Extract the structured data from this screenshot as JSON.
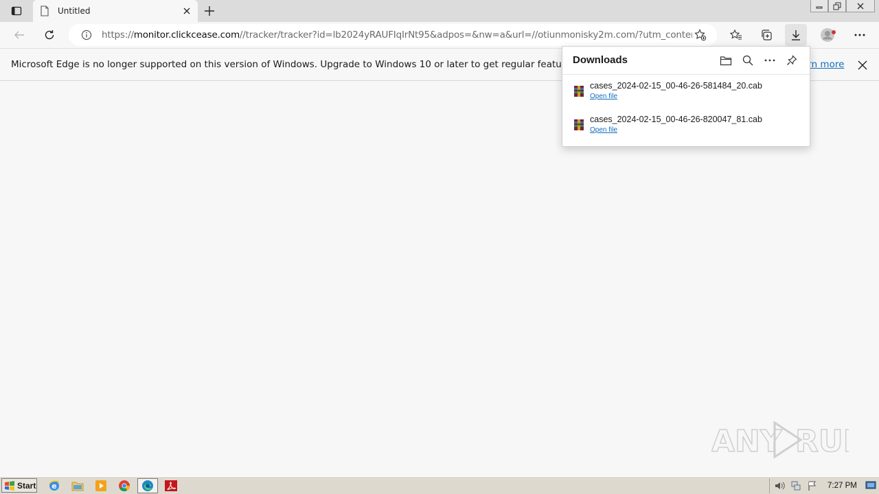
{
  "browser": {
    "tab": {
      "title": "Untitled"
    },
    "address": {
      "scheme": "https://",
      "host": "monitor.clickcease.com",
      "path": "//tracker/tracker?id=lb2024yRAUFIqIrNt95&adpos=&nw=a&url=//otiunmonisky2m.com/?utm_content=vy..."
    }
  },
  "infobar": {
    "message": "Microsoft Edge is no longer supported on this version of Windows. Upgrade to Windows 10 or later to get regular feature and security u",
    "link_text": "arn more"
  },
  "downloads": {
    "title": "Downloads",
    "items": [
      {
        "filename": "cases_2024-02-15_00-46-26-581484_20.cab",
        "action": "Open file"
      },
      {
        "filename": "cases_2024-02-15_00-46-26-820047_81.cab",
        "action": "Open file"
      }
    ]
  },
  "taskbar": {
    "start_label": "Start",
    "clock": "7:27 PM",
    "apps": [
      "internet-explorer-icon",
      "folder-icon",
      "media-player-icon",
      "chrome-icon",
      "edge-icon",
      "acrobat-icon"
    ]
  },
  "watermark": {
    "text": "ANY RUN"
  },
  "colors": {
    "accent_link": "#0f6cbd",
    "tabstrip": "#dcdcdc",
    "page_bg": "#f7f7f7",
    "taskbar": "#ded9cf",
    "profile_badge": "#d13438"
  }
}
